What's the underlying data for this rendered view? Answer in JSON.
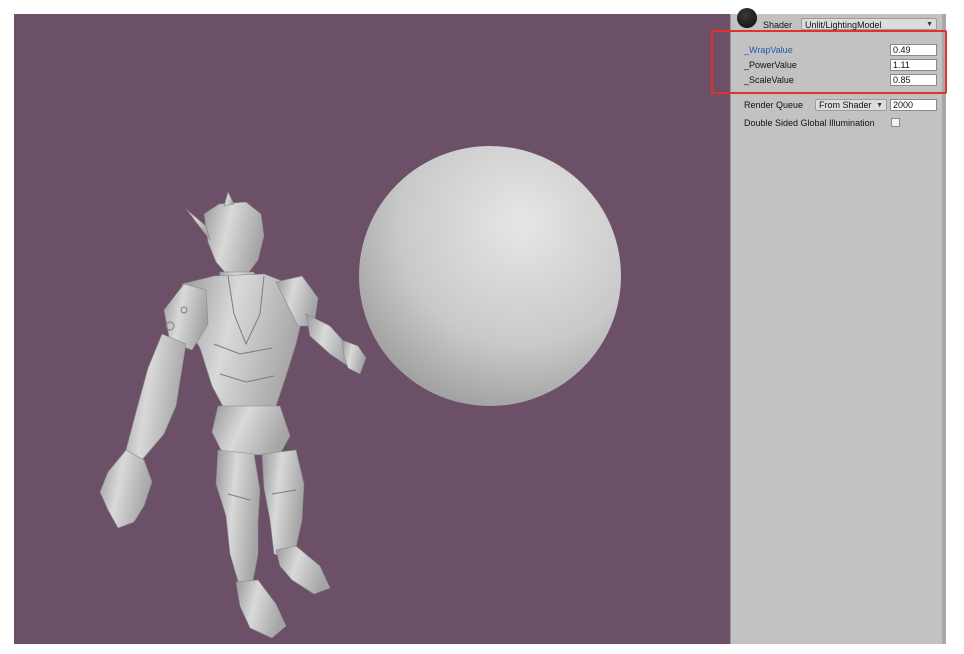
{
  "inspector": {
    "shader_label": "Shader",
    "shader_value": "Unlit/LightingModel",
    "properties": [
      {
        "name": "_WrapValue",
        "value": "0.49"
      },
      {
        "name": "_PowerValue",
        "value": "1.11"
      },
      {
        "name": "_ScaleValue",
        "value": "0.85"
      }
    ],
    "render_queue_label": "Render Queue",
    "render_queue_mode": "From Shader",
    "render_queue_value": "2000",
    "double_sided_gi_label": "Double Sided Global Illumination",
    "double_sided_gi_checked": false
  },
  "colors": {
    "viewport_background": "#6b5068",
    "inspector_background": "#c2c2c2",
    "highlight_border": "#e0332e",
    "active_property_text": "#2b56a8"
  },
  "icons": {
    "material_preview": "material-ball-icon",
    "dropdown": "chevron-down-icon"
  }
}
